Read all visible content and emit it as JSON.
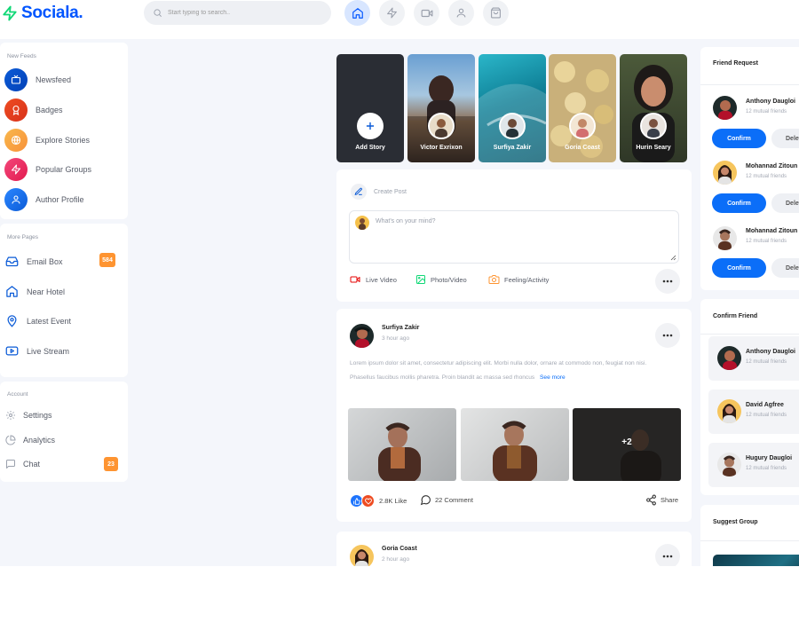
{
  "app": {
    "logo_text": "Sociala.",
    "brand_color": "#0055ff",
    "accent_color": "#10d876"
  },
  "search": {
    "placeholder": "Start typing to search.."
  },
  "nav_icons": [
    "home-icon",
    "zap-icon",
    "video-icon",
    "user-icon",
    "shopping-bag-icon"
  ],
  "sidebar": {
    "feeds_title": "New Feeds",
    "feeds": [
      {
        "label": "Newsfeed",
        "icon": "tv-icon",
        "color": "#0b5bd7"
      },
      {
        "label": "Badges",
        "icon": "award-icon",
        "color": "#ee4c22"
      },
      {
        "label": "Explore Stories",
        "icon": "globe-icon",
        "color": "#f7a63a"
      },
      {
        "label": "Popular Groups",
        "icon": "zap-icon",
        "color": "#ef2860"
      },
      {
        "label": "Author Profile",
        "icon": "user-icon",
        "color": "#1e74fd"
      }
    ],
    "pages_title": "More Pages",
    "pages": [
      {
        "label": "Email Box",
        "icon": "inbox-icon",
        "badge": "584"
      },
      {
        "label": "Near Hotel",
        "icon": "home-icon"
      },
      {
        "label": "Latest Event",
        "icon": "map-pin-icon"
      },
      {
        "label": "Live Stream",
        "icon": "youtube-icon"
      }
    ],
    "account_title": "Account",
    "account": [
      {
        "label": "Settings",
        "icon": "settings-icon"
      },
      {
        "label": "Analytics",
        "icon": "pie-chart-icon"
      },
      {
        "label": "Chat",
        "icon": "message-square-icon",
        "badge": "23"
      }
    ]
  },
  "stories": [
    {
      "name": "Add Story"
    },
    {
      "name": "Victor Exrixon"
    },
    {
      "name": "Surfiya Zakir"
    },
    {
      "name": "Goria Coast"
    },
    {
      "name": "Hurin Seary"
    }
  ],
  "composer": {
    "title": "Create Post",
    "placeholder": "What's on your mind?",
    "actions": [
      {
        "label": "Live Video",
        "icon": "video-icon",
        "color": "#e50202"
      },
      {
        "label": "Photo/Video",
        "icon": "image-icon",
        "color": "#10d876"
      },
      {
        "label": "Feeling/Activity",
        "icon": "camera-icon",
        "color": "#fe9431"
      }
    ]
  },
  "posts": [
    {
      "author": "Surfiya Zakir",
      "time": "3 hour ago",
      "text": "Lorem ipsum dolor sit amet, consectetur adipiscing elit. Morbi nulla dolor, ornare at commodo non, feugiat non nisi. Phasellus faucibus mollis pharetra. Proin blandit ac massa sed rhoncus",
      "see_more": "See more",
      "extra_photos": "+2",
      "likes": "2.8K Like",
      "comments": "22 Comment",
      "share": "Share"
    },
    {
      "author": "Goria Coast",
      "time": "2 hour ago"
    }
  ],
  "friend_requests": {
    "title": "Friend Request",
    "confirm_label": "Confirm",
    "delete_label": "Delete",
    "items": [
      {
        "name": "Anthony Daugloi",
        "sub": "12 mutual friends"
      },
      {
        "name": "Mohannad Zitoun",
        "sub": "12 mutual friends"
      },
      {
        "name": "Mohannad Zitoun",
        "sub": "12 mutual friends"
      }
    ]
  },
  "confirm_friend": {
    "title": "Confirm Friend",
    "items": [
      {
        "name": "Anthony Daugloi",
        "sub": "12 mutual friends"
      },
      {
        "name": "David Agfree",
        "sub": "12 mutual friends"
      },
      {
        "name": "Hugury Daugloi",
        "sub": "12 mutual friends"
      }
    ]
  },
  "suggest_group": {
    "title": "Suggest Group"
  }
}
